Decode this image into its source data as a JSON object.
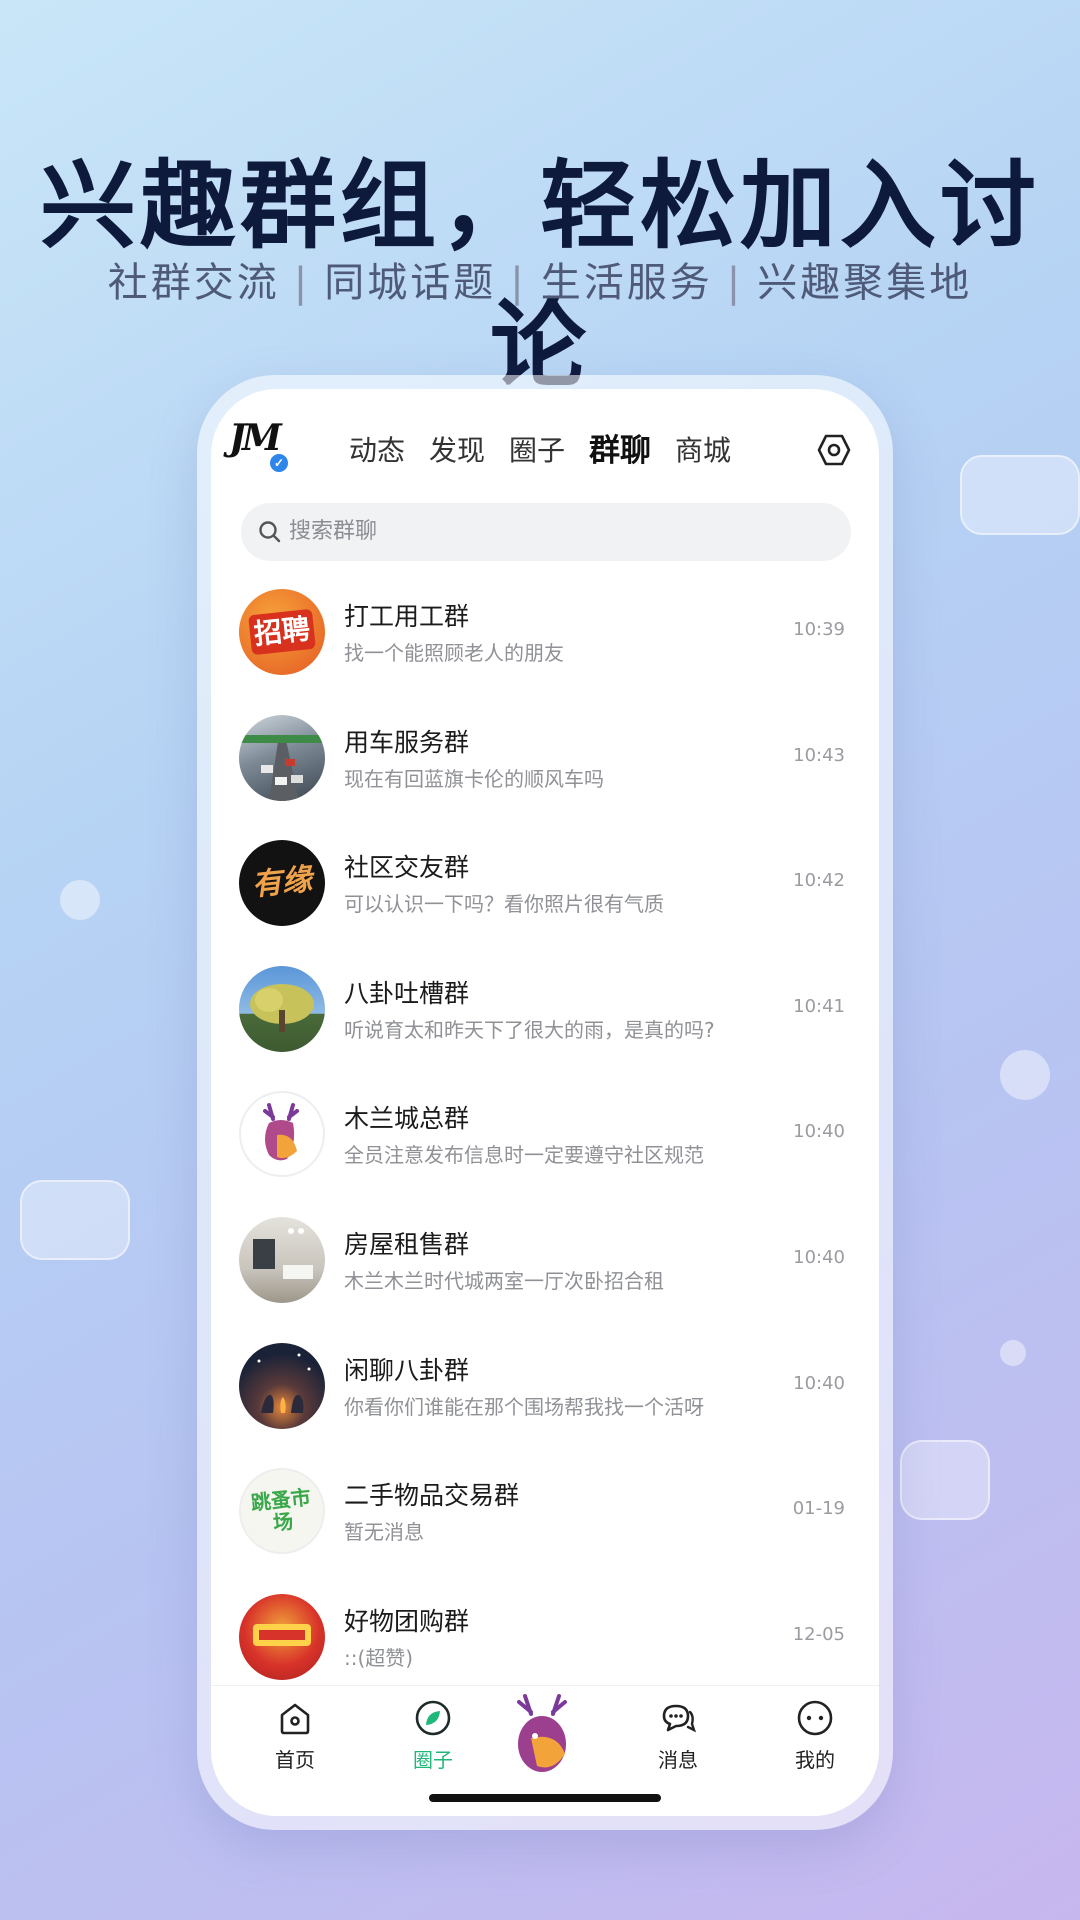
{
  "promo": {
    "headline": "兴趣群组，轻松加入讨论",
    "subtitle_items": [
      "社群交流",
      "同城话题",
      "生活服务",
      "兴趣聚集地"
    ],
    "separator": "|"
  },
  "app": {
    "logo_text": "JM",
    "tabs": [
      {
        "label": "动态",
        "active": false
      },
      {
        "label": "发现",
        "active": false
      },
      {
        "label": "圈子",
        "active": false
      },
      {
        "label": "群聊",
        "active": true
      },
      {
        "label": "商城",
        "active": false
      }
    ],
    "search": {
      "placeholder": "搜索群聊"
    },
    "groups": [
      {
        "name": "打工用工群",
        "preview": "找一个能照顾老人的朋友",
        "time": "10:39",
        "avatar_text": "招聘",
        "avatar_color": "#e9632b"
      },
      {
        "name": "用车服务群",
        "preview": "现在有回蓝旗卡伦的顺风车吗",
        "time": "10:43",
        "avatar_text": "",
        "avatar_color": "#6b7a88"
      },
      {
        "name": "社区交友群",
        "preview": "可以认识一下吗？看你照片很有气质",
        "time": "10:42",
        "avatar_text": "有缘",
        "avatar_color": "#141414"
      },
      {
        "name": "八卦吐槽群",
        "preview": "听说育太和昨天下了很大的雨，是真的吗?",
        "time": "10:41",
        "avatar_text": "",
        "avatar_color": "#4f86c6"
      },
      {
        "name": "木兰城总群",
        "preview": "全员注意发布信息时一定要遵守社区规范",
        "time": "10:40",
        "avatar_text": "",
        "avatar_color": "#ffffff"
      },
      {
        "name": "房屋租售群",
        "preview": "木兰木兰时代城两室一厅次卧招合租",
        "time": "10:40",
        "avatar_text": "",
        "avatar_color": "#c9c6bf"
      },
      {
        "name": "闲聊八卦群",
        "preview": "你看你们谁能在那个围场帮我找一个活呀",
        "time": "10:40",
        "avatar_text": "",
        "avatar_color": "#1f2a48"
      },
      {
        "name": "二手物品交易群",
        "preview": "暂无消息",
        "time": "01-19",
        "avatar_text": "跳蚤市场",
        "avatar_color": "#f4f6ef"
      },
      {
        "name": "好物团购群",
        "preview": "::(超赞)",
        "time": "12-05",
        "avatar_text": "",
        "avatar_color": "#d8332a"
      }
    ],
    "bottom_nav": [
      {
        "label": "首页",
        "icon": "home-icon",
        "active": false
      },
      {
        "label": "圈子",
        "icon": "compass-leaf-icon",
        "active": true
      },
      {
        "label": "",
        "icon": "deer-mascot-icon",
        "active": false
      },
      {
        "label": "消息",
        "icon": "chat-bubbles-icon",
        "active": false
      },
      {
        "label": "我的",
        "icon": "profile-face-icon",
        "active": false
      }
    ],
    "colors": {
      "accent_green": "#1fb77a",
      "verified_blue": "#2f86ea"
    }
  }
}
